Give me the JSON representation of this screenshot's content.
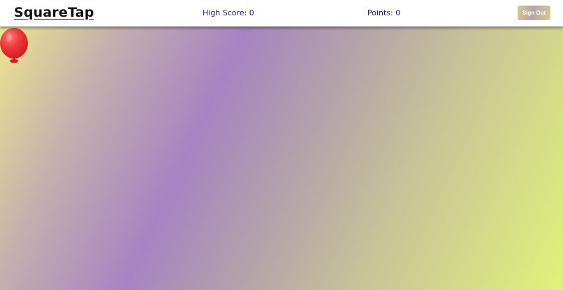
{
  "app": {
    "title": "SquareTap"
  },
  "header": {
    "high_score_label": "High Score: 0",
    "points_label": "Points: 0",
    "sign_out_label": "Sign Out"
  },
  "game": {
    "high_score": 0,
    "points": 0,
    "target_icon": "balloon-icon",
    "target_color": "#f23a3a",
    "background_colors": [
      "#ece48f",
      "#a883c2",
      "#e0f27a"
    ]
  }
}
